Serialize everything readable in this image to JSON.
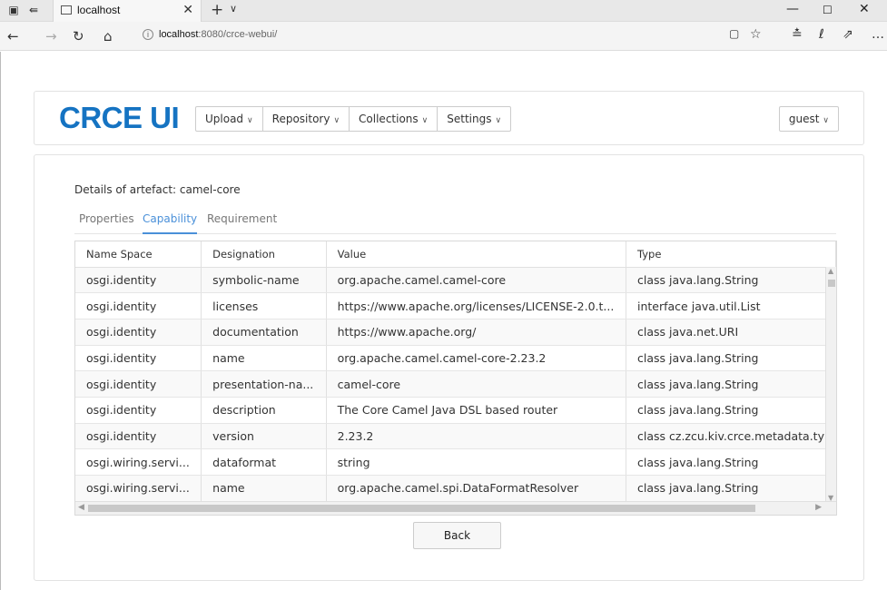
{
  "browser": {
    "tab_title": "localhost",
    "url_host": "localhost",
    "url_rest": ":8080/crce-webui/",
    "icons": {
      "tab_actions": "tab-actions-icon",
      "tab_switch": "tab-switch-icon",
      "page": "page-icon",
      "close": "close-icon",
      "new_tab": "plus-icon",
      "tab_menu": "chevron-down-icon",
      "back": "back-arrow-icon",
      "forward": "forward-arrow-icon",
      "refresh": "refresh-icon",
      "home": "home-icon",
      "info": "info-icon",
      "reading_view": "reading-view-icon",
      "favorite": "star-icon",
      "favorites_hub": "favorites-hub-icon",
      "ink": "pen-icon",
      "share": "share-icon",
      "more": "more-icon"
    }
  },
  "nav": {
    "brand": "CRCE UI",
    "menu": [
      "Upload",
      "Repository",
      "Collections",
      "Settings"
    ],
    "user": "guest",
    "brand_color": "#1573c2"
  },
  "details": {
    "title": "Details of artefact: camel-core",
    "tabs": [
      "Properties",
      "Capability",
      "Requirement"
    ],
    "active_tab": "Capability",
    "accent_color": "#4a90d9"
  },
  "table": {
    "columns": [
      "Name Space",
      "Designation",
      "Value",
      "Type"
    ],
    "rows": [
      [
        "osgi.identity",
        "symbolic-name",
        "org.apache.camel.camel-core",
        "class java.lang.String"
      ],
      [
        "osgi.identity",
        "licenses",
        "https://www.apache.org/licenses/LICENSE-2.0.t...",
        "interface java.util.List"
      ],
      [
        "osgi.identity",
        "documentation",
        "https://www.apache.org/",
        "class java.net.URI"
      ],
      [
        "osgi.identity",
        "name",
        "org.apache.camel.camel-core-2.23.2",
        "class java.lang.String"
      ],
      [
        "osgi.identity",
        "presentation-na...",
        "camel-core",
        "class java.lang.String"
      ],
      [
        "osgi.identity",
        "description",
        "The Core Camel Java DSL based router",
        "class java.lang.String"
      ],
      [
        "osgi.identity",
        "version",
        "2.23.2",
        "class cz.zcu.kiv.crce.metadata.ty"
      ],
      [
        "osgi.wiring.servi...",
        "dataformat",
        "string",
        "class java.lang.String"
      ],
      [
        "osgi.wiring.servi...",
        "name",
        "org.apache.camel.spi.DataFormatResolver",
        "class java.lang.String"
      ]
    ]
  },
  "back_label": "Back"
}
